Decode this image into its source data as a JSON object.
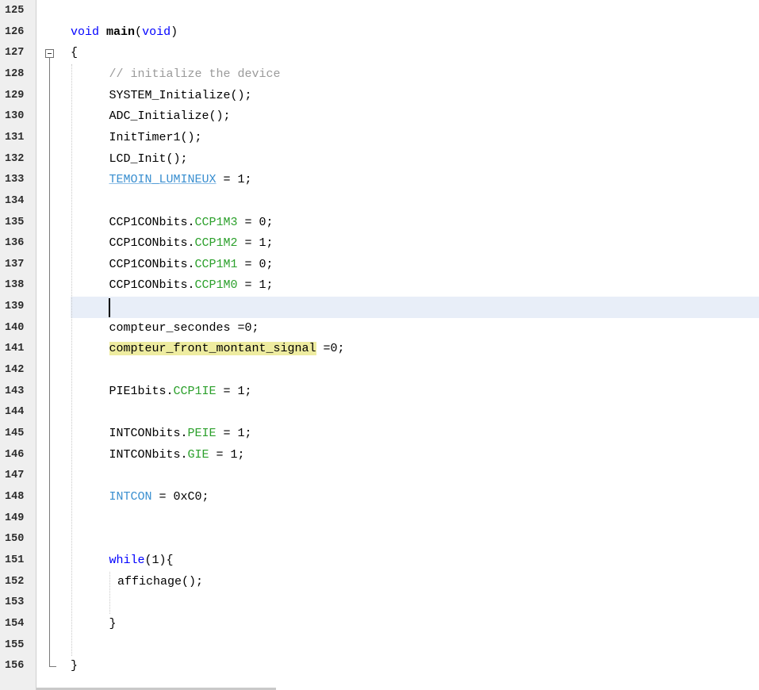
{
  "editor": {
    "lines": [
      {
        "num": "125",
        "indent": 0,
        "tokens": []
      },
      {
        "num": "126",
        "indent": 0,
        "tokens": [
          {
            "t": "void",
            "c": "kw"
          },
          {
            "t": " "
          },
          {
            "t": "main",
            "c": "bold"
          },
          {
            "t": "("
          },
          {
            "t": "void",
            "c": "kw"
          },
          {
            "t": ")"
          }
        ]
      },
      {
        "num": "127",
        "indent": 0,
        "tokens": [
          {
            "t": "{"
          }
        ]
      },
      {
        "num": "128",
        "indent": 1,
        "tokens": [
          {
            "t": "// initialize the device",
            "c": "comment"
          }
        ]
      },
      {
        "num": "129",
        "indent": 1,
        "tokens": [
          {
            "t": "SYSTEM_Initialize();"
          }
        ]
      },
      {
        "num": "130",
        "indent": 1,
        "tokens": [
          {
            "t": "ADC_Initialize();"
          }
        ]
      },
      {
        "num": "131",
        "indent": 1,
        "tokens": [
          {
            "t": "InitTimer1();"
          }
        ]
      },
      {
        "num": "132",
        "indent": 1,
        "tokens": [
          {
            "t": "LCD_Init();"
          }
        ]
      },
      {
        "num": "133",
        "indent": 1,
        "tokens": [
          {
            "t": "TEMOIN_LUMINEUX",
            "c": "macro"
          },
          {
            "t": " = 1;"
          }
        ]
      },
      {
        "num": "134",
        "indent": 1,
        "tokens": []
      },
      {
        "num": "135",
        "indent": 1,
        "tokens": [
          {
            "t": "CCP1CONbits."
          },
          {
            "t": "CCP1M3",
            "c": "field"
          },
          {
            "t": " = 0;"
          }
        ]
      },
      {
        "num": "136",
        "indent": 1,
        "tokens": [
          {
            "t": "CCP1CONbits."
          },
          {
            "t": "CCP1M2",
            "c": "field"
          },
          {
            "t": " = 1;"
          }
        ]
      },
      {
        "num": "137",
        "indent": 1,
        "tokens": [
          {
            "t": "CCP1CONbits."
          },
          {
            "t": "CCP1M1",
            "c": "field"
          },
          {
            "t": " = 0;"
          }
        ]
      },
      {
        "num": "138",
        "indent": 1,
        "tokens": [
          {
            "t": "CCP1CONbits."
          },
          {
            "t": "CCP1M0",
            "c": "field"
          },
          {
            "t": " = 1;"
          }
        ]
      },
      {
        "num": "139",
        "indent": 1,
        "tokens": [],
        "current": true
      },
      {
        "num": "140",
        "indent": 1,
        "tokens": [
          {
            "t": "compteur_secondes =0;"
          }
        ]
      },
      {
        "num": "141",
        "indent": 1,
        "tokens": [
          {
            "t": "compteur_front_montant_signal",
            "c": "hl"
          },
          {
            "t": " =0;"
          }
        ]
      },
      {
        "num": "142",
        "indent": 1,
        "tokens": []
      },
      {
        "num": "143",
        "indent": 1,
        "tokens": [
          {
            "t": "PIE1bits."
          },
          {
            "t": "CCP1IE",
            "c": "field"
          },
          {
            "t": " = 1;"
          }
        ]
      },
      {
        "num": "144",
        "indent": 1,
        "tokens": []
      },
      {
        "num": "145",
        "indent": 1,
        "tokens": [
          {
            "t": "INTCONbits."
          },
          {
            "t": "PEIE",
            "c": "field"
          },
          {
            "t": " = 1;"
          }
        ]
      },
      {
        "num": "146",
        "indent": 1,
        "tokens": [
          {
            "t": "INTCONbits."
          },
          {
            "t": "GIE",
            "c": "field"
          },
          {
            "t": " = 1;"
          }
        ]
      },
      {
        "num": "147",
        "indent": 1,
        "tokens": []
      },
      {
        "num": "148",
        "indent": 1,
        "tokens": [
          {
            "t": "INTCON",
            "c": "macro-plain"
          },
          {
            "t": " = 0xC0;"
          }
        ]
      },
      {
        "num": "149",
        "indent": 1,
        "tokens": []
      },
      {
        "num": "150",
        "indent": 1,
        "tokens": []
      },
      {
        "num": "151",
        "indent": 1,
        "tokens": [
          {
            "t": "while",
            "c": "kw"
          },
          {
            "t": "(1){"
          }
        ]
      },
      {
        "num": "152",
        "indent": 2,
        "tokens": [
          {
            "t": "affichage();"
          }
        ]
      },
      {
        "num": "153",
        "indent": 1,
        "tokens": []
      },
      {
        "num": "154",
        "indent": 1,
        "tokens": [
          {
            "t": "}"
          }
        ]
      },
      {
        "num": "155",
        "indent": 0,
        "tokens": []
      },
      {
        "num": "156",
        "indent": 0,
        "tokens": [
          {
            "t": "}"
          }
        ]
      }
    ]
  },
  "icons": {
    "fold": "fold-collapse-icon",
    "caret": "text-caret-icon"
  },
  "colors": {
    "keyword": "#0000ff",
    "comment": "#9a9a9a",
    "macro": "#3a8fd0",
    "field": "#2ca02c",
    "highlight": "#eeeca0",
    "current_line": "#e8eef8",
    "gutter": "#efefef"
  }
}
